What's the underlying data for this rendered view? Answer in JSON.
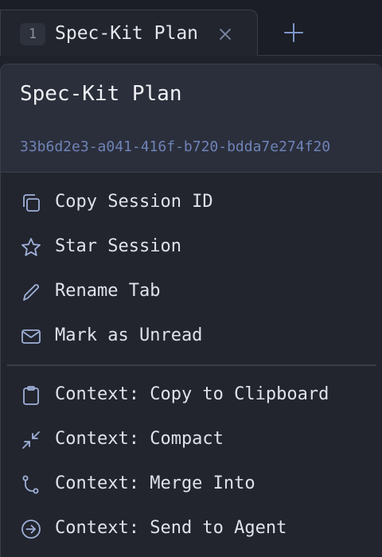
{
  "tab": {
    "number": "1",
    "title": "Spec-Kit Plan"
  },
  "menu": {
    "title": "Spec-Kit Plan",
    "session_id": "33b6d2e3-a041-416f-b720-bdda7e274f20",
    "group1": [
      {
        "label": "Copy Session ID",
        "icon": "copy-icon"
      },
      {
        "label": "Star Session",
        "icon": "star-icon"
      },
      {
        "label": "Rename Tab",
        "icon": "pencil-icon"
      },
      {
        "label": "Mark as Unread",
        "icon": "envelope-icon"
      }
    ],
    "group2": [
      {
        "label": "Context: Copy to Clipboard",
        "icon": "clipboard-icon"
      },
      {
        "label": "Context: Compact",
        "icon": "compress-icon"
      },
      {
        "label": "Context: Merge Into",
        "icon": "merge-icon"
      },
      {
        "label": "Context: Send to Agent",
        "icon": "send-arrow-icon"
      }
    ]
  },
  "colors": {
    "background": "#1f222b",
    "header": "#2b2f3b",
    "session_id": "#6f83b8",
    "icon": "#9fb0d8"
  }
}
